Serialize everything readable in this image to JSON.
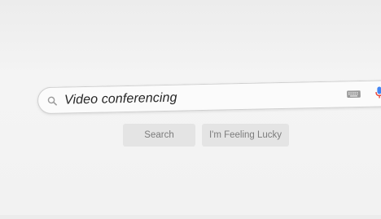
{
  "search": {
    "query": "Video conferencing",
    "icons": {
      "search": "search-icon",
      "keyboard": "keyboard-icon",
      "microphone": "microphone-icon"
    }
  },
  "buttons": {
    "search_label": "Search",
    "lucky_label": "I'm Feeling Lucky"
  },
  "colors": {
    "mic_blue": "#4285f4",
    "mic_red": "#ea4335"
  }
}
